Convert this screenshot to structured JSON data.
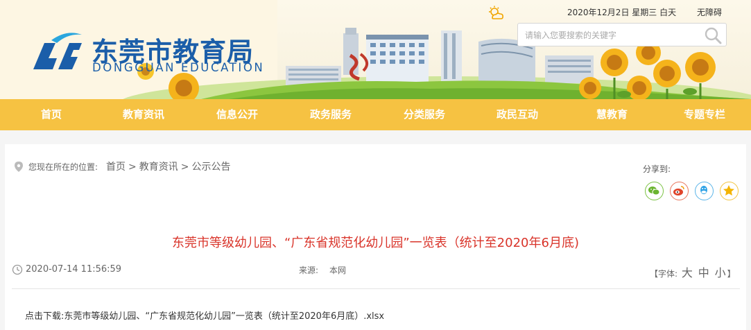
{
  "header": {
    "date": "2020年12月2日 星期三 白天",
    "accessibility": "无障碍",
    "logo_cn": "东莞市教育局",
    "logo_en": "DONGGUAN EDUCATION",
    "search_placeholder": "请输入您要搜索的关键字",
    "weather_icon": "partly-cloudy-icon",
    "search_icon": "magnifier-icon"
  },
  "nav": {
    "items": [
      "首页",
      "教育资讯",
      "信息公开",
      "政务服务",
      "分类服务",
      "政民互动",
      "慧教育",
      "专题专栏"
    ]
  },
  "breadcrumb": {
    "label": "您现在所在的位置:",
    "items": [
      "首页",
      "教育资讯",
      "公示公告"
    ],
    "separator": ">"
  },
  "share": {
    "label": "分享到:",
    "targets": [
      "wechat-icon",
      "weibo-icon",
      "qq-icon",
      "qzone-icon"
    ]
  },
  "article": {
    "title": "东莞市等级幼儿园、“广东省规范化幼儿园”一览表（统计至2020年6月底)",
    "datetime": "2020-07-14 11:56:59",
    "source_label": "来源:",
    "source": "本网",
    "font_label": "【字体:",
    "font_large": "大",
    "font_medium": "中",
    "font_small": "小",
    "font_close": "】",
    "download_label": "点击下载:",
    "download_file": "东莞市等级幼儿园、“广东省规范化幼儿园”一览表（统计至2020年6月底）.xlsx"
  },
  "colors": {
    "nav_bg": "#f6c242",
    "brand_blue": "#1b5ea9",
    "title_red": "#d9342a"
  }
}
